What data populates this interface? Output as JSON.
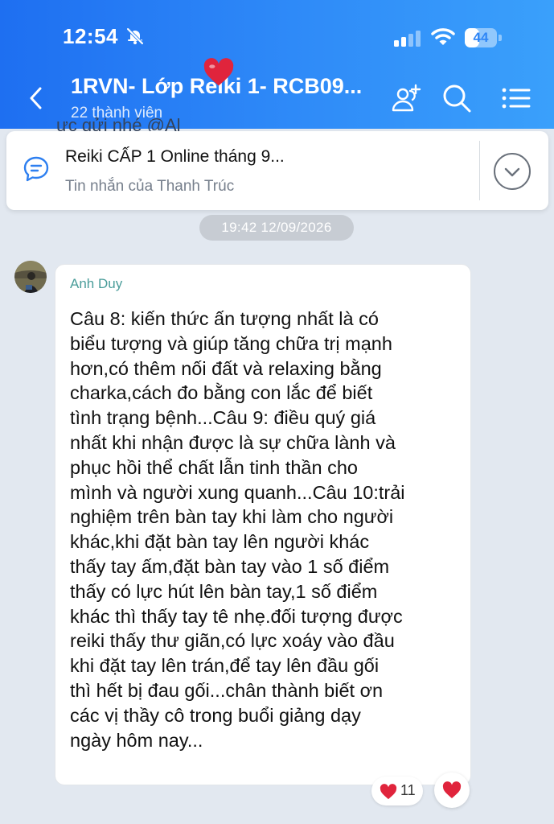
{
  "status_bar": {
    "time": "12:54",
    "battery_level": "44",
    "battery_percent": 44
  },
  "header": {
    "title": "1RVN- Lớp Reiki 1- RCB09...",
    "subtitle": "22 thành viên",
    "icons": [
      "back-arrow-icon",
      "add-member-icon",
      "search-icon",
      "menu-list-icon",
      "heart-icon"
    ]
  },
  "peek_message": "ưc gửi nhé @Al",
  "pinned_message": {
    "title": "Reiki CẤP 1 Online tháng 9...",
    "subtitle": "Tin nhắn của Thanh Trúc",
    "icon": "message-icon",
    "expand_icon": "chevron-down-icon"
  },
  "timestamp": "19:42 12/09/2026",
  "message": {
    "sender": "Anh Duy",
    "lines": [
      "Câu 8: kiến thức ấn tượng nhất là có",
      "biểu tượng và giúp tăng chữa trị mạnh",
      "hơn,có thêm nối đất và relaxing bằng",
      "charka,cách đo bằng con lắc để biết",
      "tình trạng bệnh...Câu 9: điều quý giá",
      "nhất khi nhận được là sự chữa lành và",
      "phục hồi thể chất lẫn tinh thần cho",
      "mình và người xung quanh...Câu 10:trải",
      "nghiệm trên bàn tay khi làm cho người",
      "khác,khi đặt bàn tay lên người khác",
      "thấy tay ấm,đặt bàn tay vào 1 số điểm",
      "thấy có lực hút lên bàn tay,1 số điểm",
      "khác thì thấy tay tê nhẹ.đối tượng được",
      "reiki thấy thư giãn,có lực xoáy vào đầu",
      "khi đặt tay lên trán,để tay lên đầu gối",
      "thì hết bị đau gối...chân thành biết ơn",
      "các vị thầy cô trong buổi giảng dạy",
      "ngày hôm nay..."
    ],
    "reaction": {
      "icon": "heart-icon",
      "count": "11"
    }
  },
  "colors": {
    "header_start": "#1e6ff1",
    "header_end": "#3aa0fb",
    "background": "#e2e8f0",
    "sender_name": "#4a9d9a",
    "heart": "#e0243c"
  }
}
